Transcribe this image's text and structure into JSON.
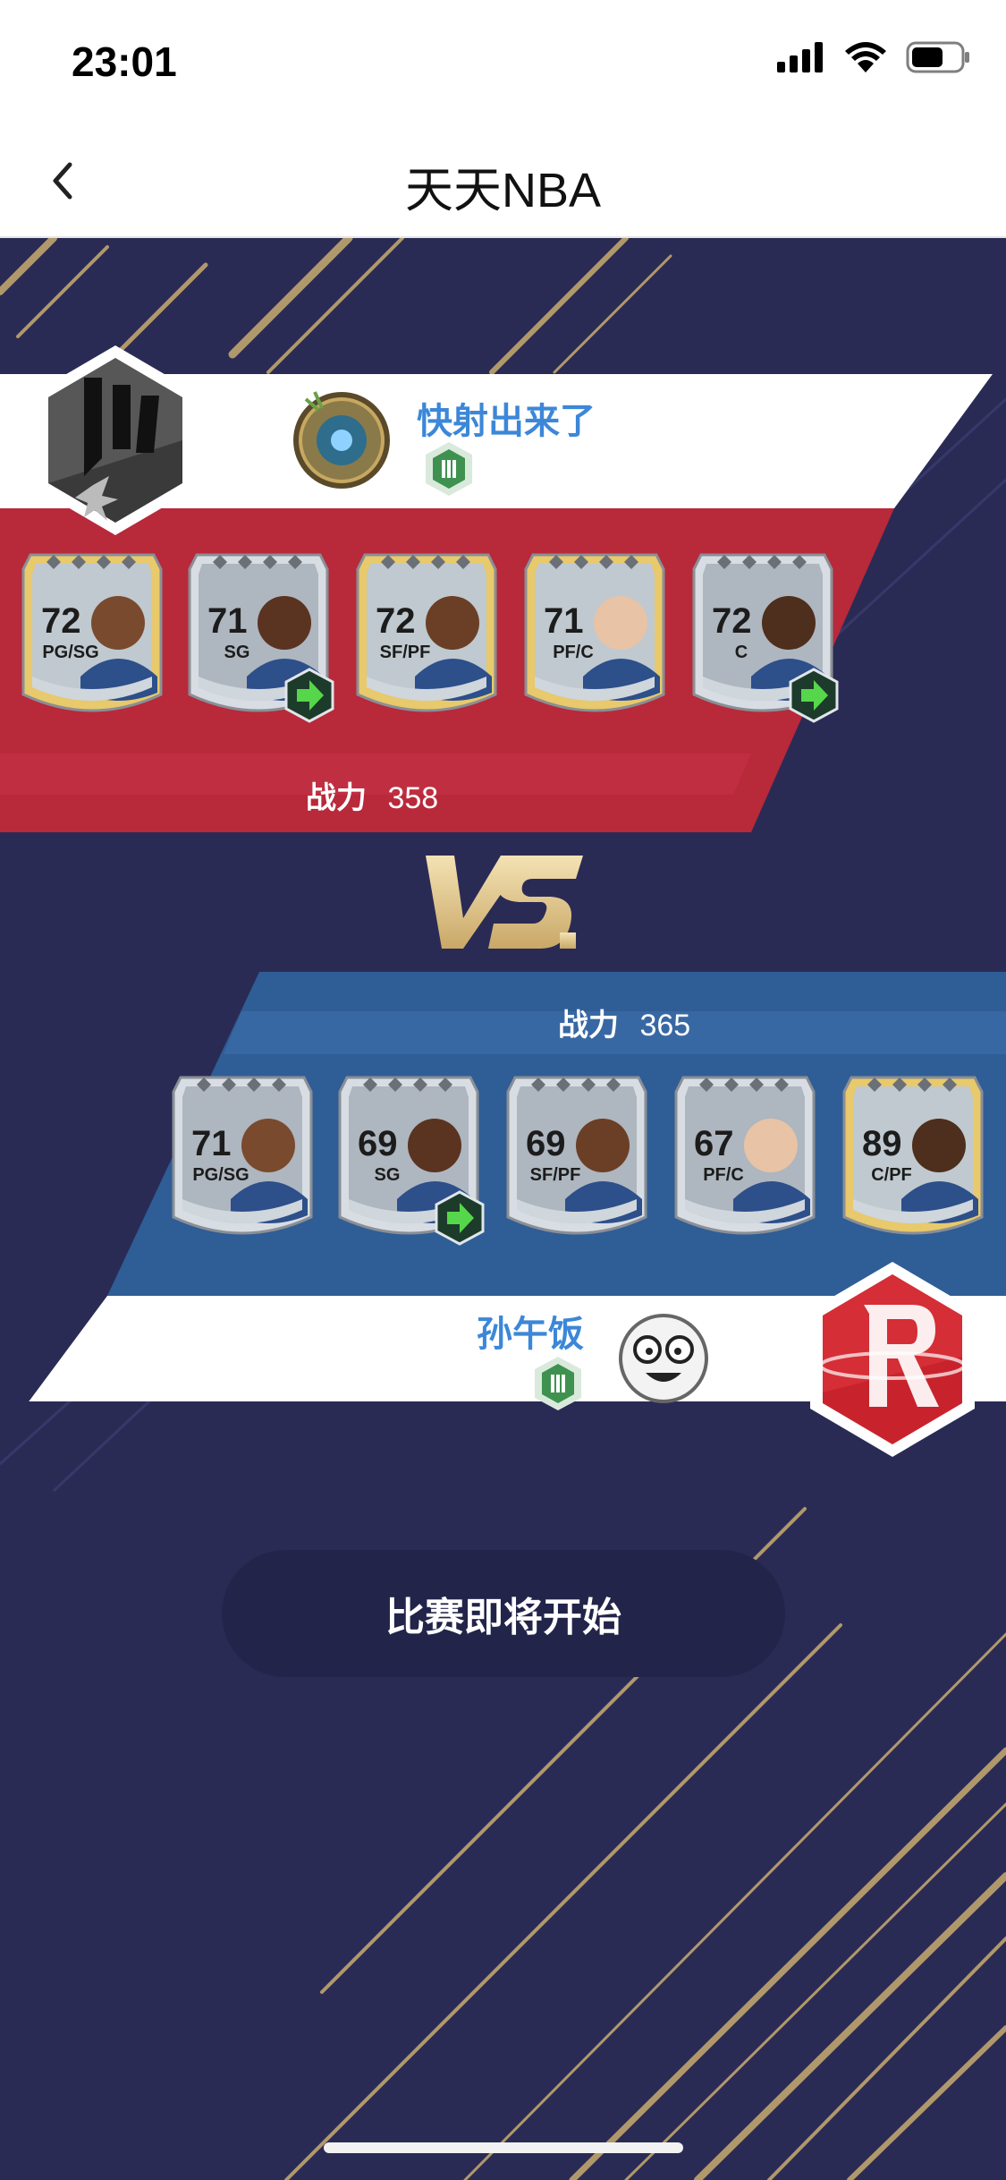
{
  "status": {
    "time": "23:01"
  },
  "nav": {
    "title": "天天NBA"
  },
  "home_team": {
    "player_name": "快射出来了",
    "power_label": "战力",
    "power_value": "358",
    "cards": [
      {
        "rating": "72",
        "pos": "PG/SG",
        "tier": "gold",
        "upgrade": false
      },
      {
        "rating": "71",
        "pos": "SG",
        "tier": "silver",
        "upgrade": true
      },
      {
        "rating": "72",
        "pos": "SF/PF",
        "tier": "gold",
        "upgrade": false
      },
      {
        "rating": "71",
        "pos": "PF/C",
        "tier": "gold",
        "upgrade": false
      },
      {
        "rating": "72",
        "pos": "C",
        "tier": "silver",
        "upgrade": true
      }
    ]
  },
  "vs_text": "VS.",
  "away_team": {
    "player_name": "孙午饭",
    "power_label": "战力",
    "power_value": "365",
    "cards": [
      {
        "rating": "71",
        "pos": "PG/SG",
        "tier": "silver",
        "upgrade": false
      },
      {
        "rating": "69",
        "pos": "SG",
        "tier": "silver",
        "upgrade": true
      },
      {
        "rating": "69",
        "pos": "SF/PF",
        "tier": "silver",
        "upgrade": false
      },
      {
        "rating": "67",
        "pos": "PF/C",
        "tier": "silver",
        "upgrade": false
      },
      {
        "rating": "89",
        "pos": "C/PF",
        "tier": "gold",
        "upgrade": false
      }
    ]
  },
  "start_button": "比赛即将开始",
  "colors": {
    "background": "#2a2b55",
    "home_red": "#b8293a",
    "away_blue": "#2f5d96",
    "gold": "#d4b373",
    "name_blue": "#3c87d8"
  }
}
